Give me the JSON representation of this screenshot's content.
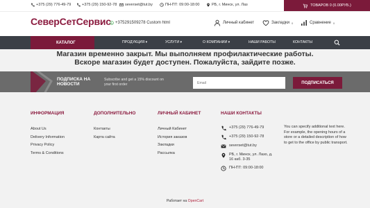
{
  "topbar": {
    "phone1": "+375 (29) 776-49-79",
    "phone2": "+375 (29) 150-92-78",
    "email": "severset@tut.by",
    "hours": "ПН-ПТ: 09:00-18:00",
    "address": "РБ, г. Минск, ул. Лаз",
    "cart": "ТОВАРОВ 0 (0.00РУБ.)"
  },
  "header": {
    "logo": "СеверСетСервис",
    "phone_line": "+375291509278 Custom html",
    "account": "Личный кабинет",
    "wishlist": "Закладки",
    "wishlist_count": "0",
    "compare": "Сравнение",
    "compare_count": "0"
  },
  "nav": {
    "catalog": "КАТАЛОГ",
    "items": [
      "ПРОДУКЦИЯ",
      "УСЛУГИ",
      "О КОМПАНИИ",
      "НАШИ РАБОТЫ",
      "КОНТАКТЫ"
    ]
  },
  "closed": {
    "line1": "Магазин временно закрыт. Мы выполняем профилактические работы.",
    "line2": "Вскоре магазин будет доступен. Пожалуйста, зайдите позже."
  },
  "subscribe": {
    "title_line1": "ПОДПИСКА НА",
    "title_line2": "НОВОСТИ",
    "text_line1": "Subscribe and get a 15% discount on",
    "text_line2": "your first order",
    "placeholder": "Email",
    "button": "ПОДПИСАТЬСЯ"
  },
  "footer": {
    "info": {
      "title": "ИНФОРМАЦИЯ",
      "links": [
        "About Us",
        "Delivery Information",
        "Privacy Policy",
        "Terms & Conditions"
      ]
    },
    "extra": {
      "title": "ДОПОЛНИТЕЛЬНО",
      "links": [
        "Контакты",
        "Карта сайта"
      ]
    },
    "account": {
      "title": "ЛИЧНЫЙ КАБИНЕТ",
      "links": [
        "Личный Кабинет",
        "История заказов",
        "Закладки",
        "Рассылка"
      ]
    },
    "contacts": {
      "title": "НАШИ КОНТАКТЫ",
      "phone1": "+375 (29) 776-49-79",
      "phone2": "+375 (29) 150-92-78",
      "email": "severset@tut.by",
      "address_line1": "РБ, г. Минск, ул. Лазо, д.",
      "address_line2": "16 каб. 3-35",
      "hours": "ПН-ПТ: 09:00-18:00"
    },
    "description": "You can specify additional text here. For example, the opening hours of a store or a detailed description of how to get to the office by public transport.",
    "powered_prefix": "Работает на",
    "powered_brand": "OpenCart"
  },
  "colors": {
    "brand": "#7b1a3a",
    "nav_bg": "#3b3f46",
    "subscribe_bg": "#6b6b6b"
  }
}
